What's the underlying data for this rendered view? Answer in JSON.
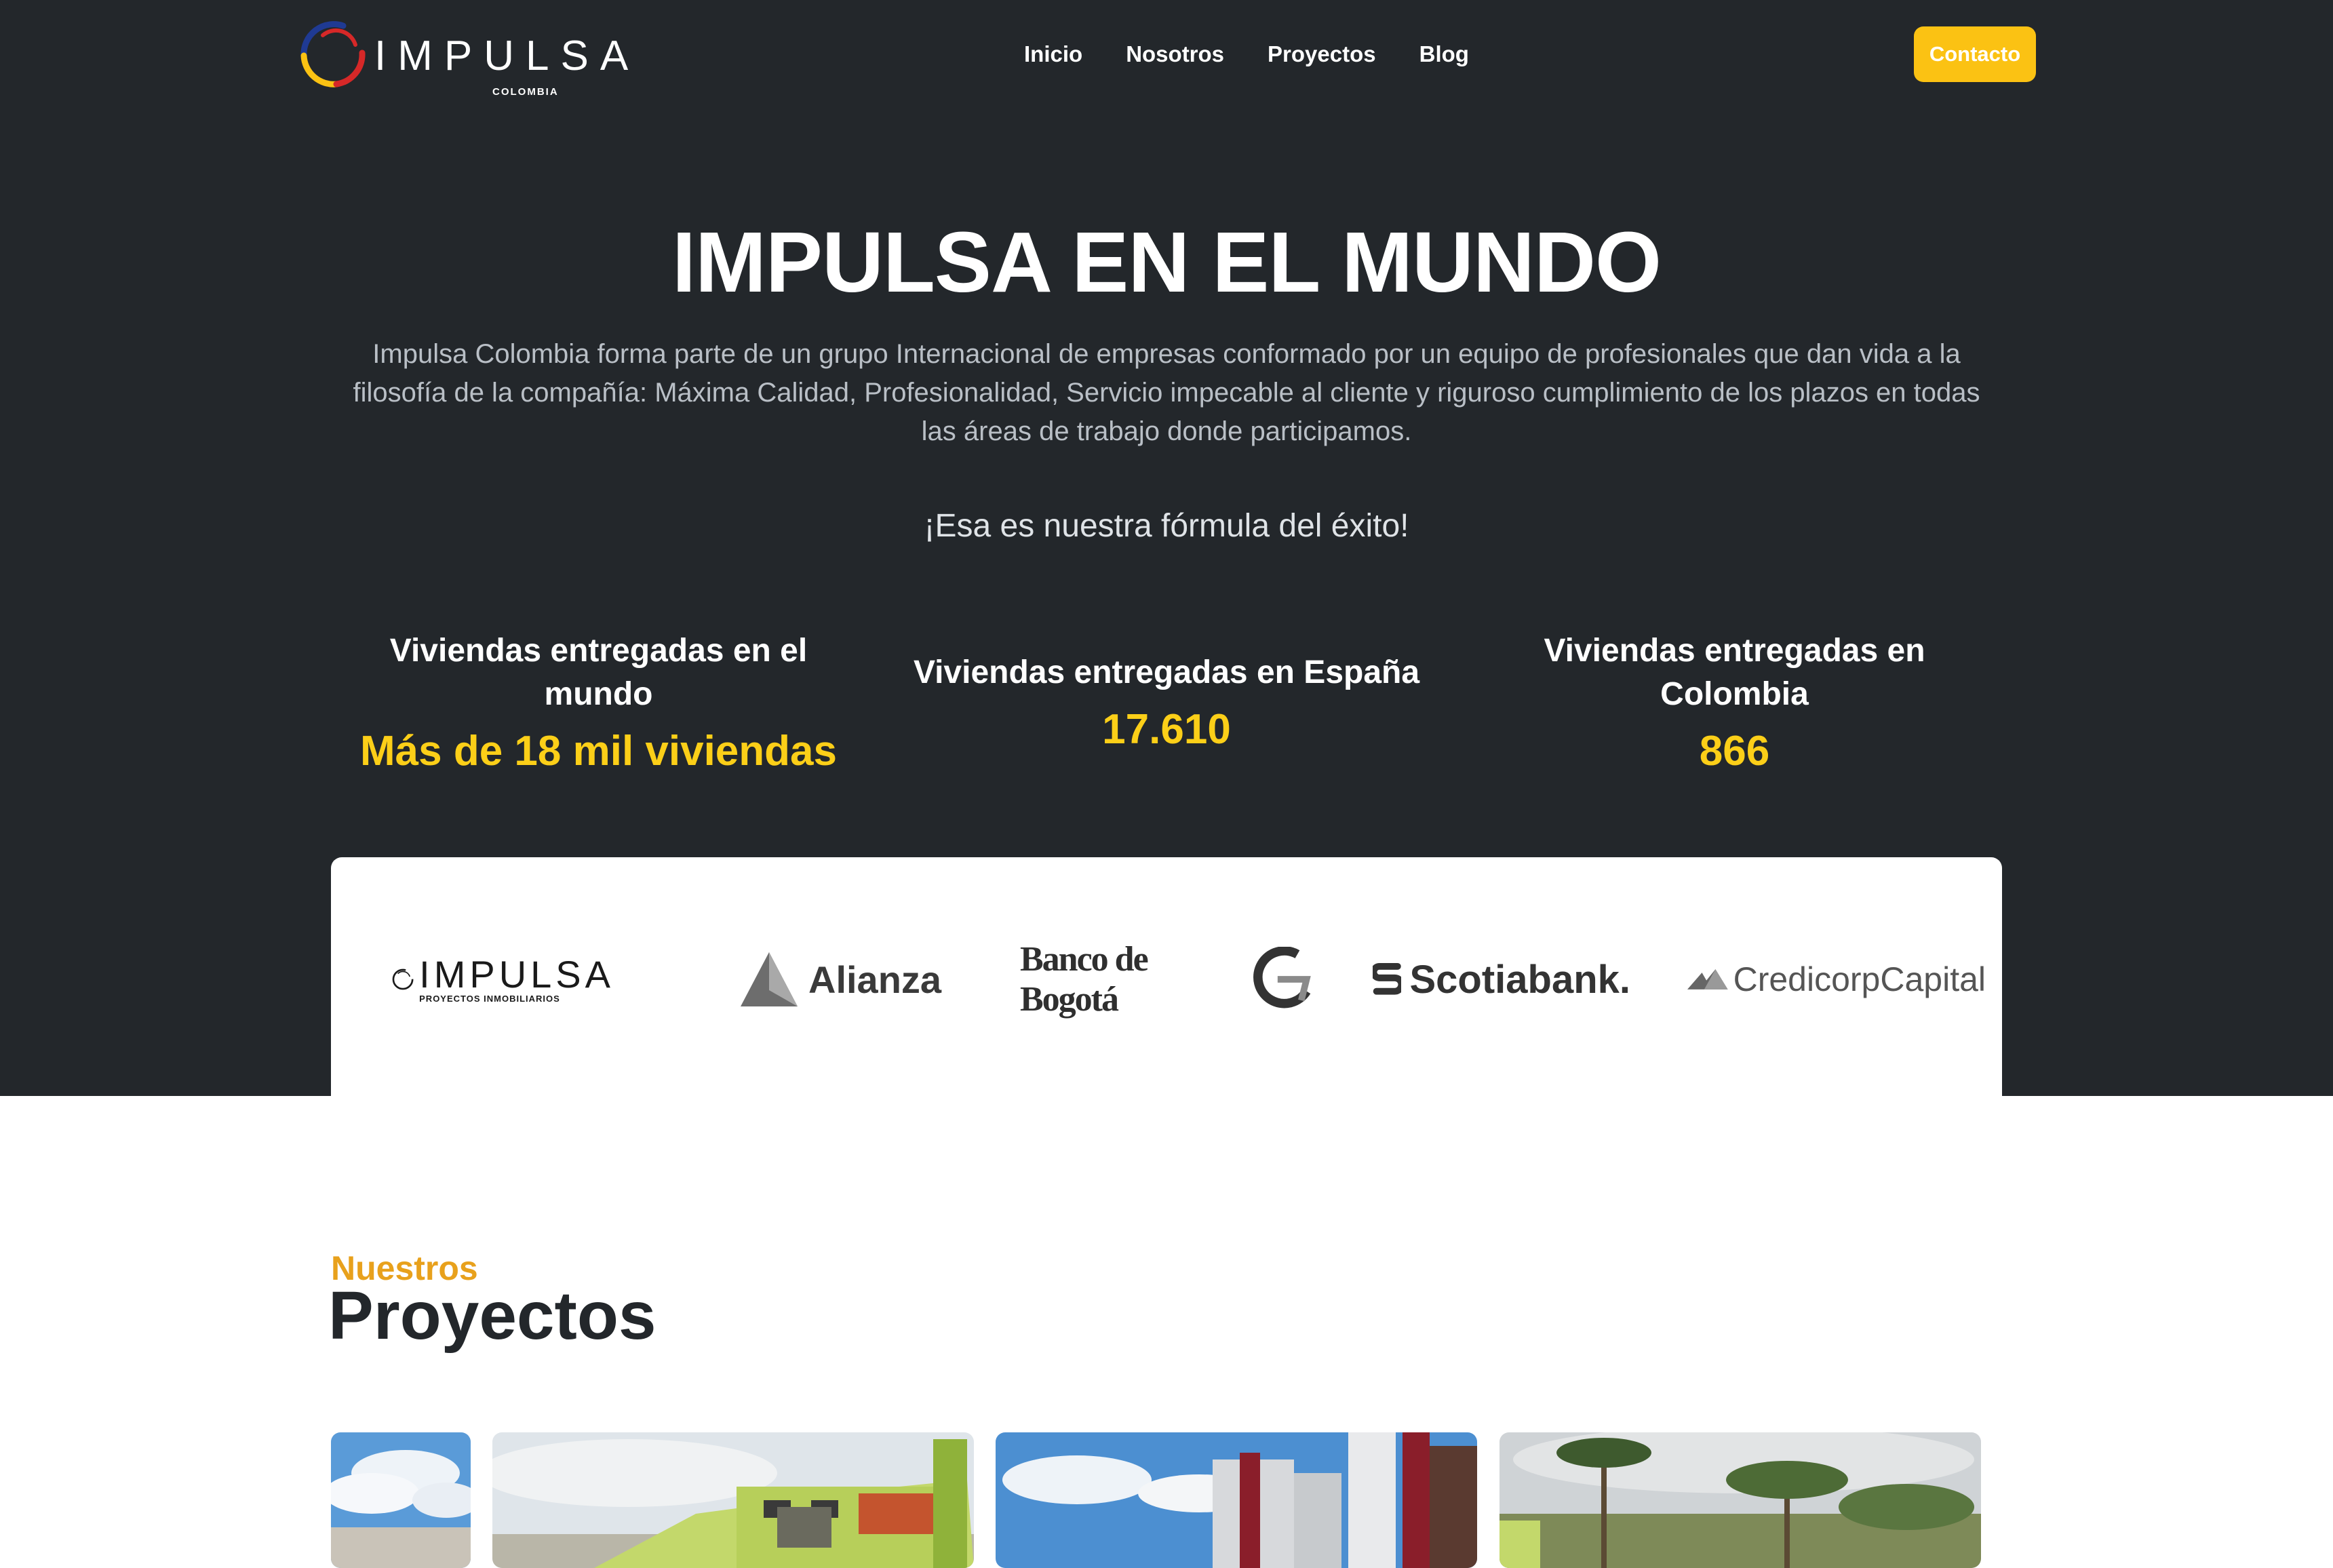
{
  "nav": {
    "logo": {
      "word": "IMPULSA",
      "sub": "COLOMBIA"
    },
    "links": [
      "Inicio",
      "Nosotros",
      "Proyectos",
      "Blog"
    ],
    "cta": "Contacto"
  },
  "hero": {
    "title": "IMPULSA EN EL MUNDO",
    "description": "Impulsa Colombia forma parte de un grupo Internacional de empresas conformado por un equipo de profesionales que dan vida a la filosofía de la compañía: Máxima Calidad, Profesionalidad, Servicio impecable al cliente y riguroso cumplimiento de los plazos en todas las áreas de trabajo donde participamos.",
    "tagline": "¡Esa es nuestra fórmula del éxito!"
  },
  "stats": [
    {
      "label": "Viviendas entregadas en el mundo",
      "value": "Más de 18 mil viviendas"
    },
    {
      "label": "Viviendas entregadas en España",
      "value": "17.610"
    },
    {
      "label": "Viviendas entregadas en Colombia",
      "value": "866"
    }
  ],
  "partners": {
    "impulsa": {
      "word": "IMPULSA",
      "sub": "PROYECTOS INMOBILIARIOS"
    },
    "alianza": "Alianza",
    "bogota": "Banco de Bogotá",
    "scotiabank": "Scotiabank.",
    "credicorp": "CredicorpCapital"
  },
  "projects": {
    "kicker": "Nuestros",
    "title": "Proyectos"
  },
  "colors": {
    "background_dark": "#23272b",
    "accent_yellow": "#fbc213",
    "kicker_orange": "#e8a11c"
  }
}
